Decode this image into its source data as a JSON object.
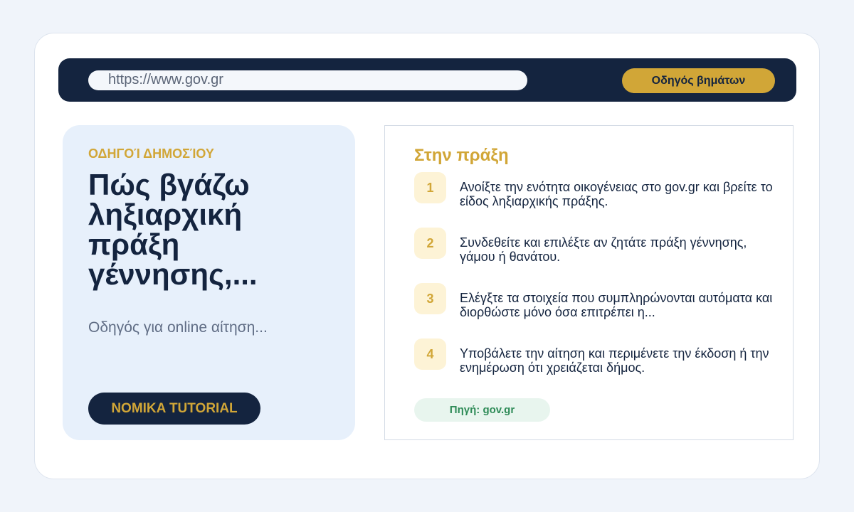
{
  "browser": {
    "url": "https://www.gov.gr",
    "guide_button": "Οδηγός βημάτων"
  },
  "hero": {
    "eyebrow": "ΟΔΗΓΟΊ ΔΗΜΟΣΊΟΥ",
    "title": "Πώς βγάζω ληξιαρχική πράξη γέννησης,...",
    "subtitle": "Οδηγός για online αίτηση...",
    "cta": "NOMIKA TUTORIAL"
  },
  "steps_panel": {
    "title": "Στην πράξη",
    "steps": [
      {
        "number": "1",
        "text": "Ανοίξτε την ενότητα οικογένειας στο gov.gr και βρείτε το είδος ληξιαρχικής πράξης."
      },
      {
        "number": "2",
        "text": "Συνδεθείτε και επιλέξτε αν ζητάτε πράξη γέννησης, γάμου ή θανάτου."
      },
      {
        "number": "3",
        "text": "Ελέγξτε τα στοιχεία που συμπληρώνονται αυτόματα και διορθώστε μόνο όσα επιτρέπει η..."
      },
      {
        "number": "4",
        "text": "Υποβάλετε την αίτηση και περιμένετε την έκδοση ή την ενημέρωση ότι χρειάζεται δήμος."
      }
    ],
    "source": "Πηγή: gov.gr"
  }
}
